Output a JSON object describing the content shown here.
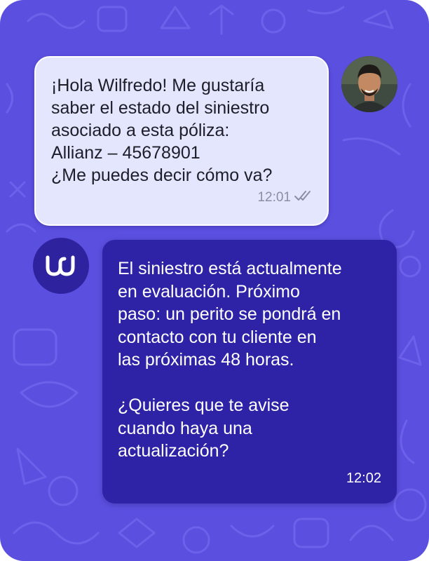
{
  "chat": {
    "user_message": {
      "text": "¡Hola Wilfredo! Me gustaría\nsaber el estado del siniestro\nasociado a esta póliza:\n Allianz – 45678901\n¿Me puedes decir cómo va?",
      "time": "12:01",
      "status_icon": "double-check-icon",
      "avatar_icon": "user-avatar"
    },
    "bot_message": {
      "text": "El siniestro está actualmente\nen evaluación. Próximo\npaso: un perito se pondrá en\ncontacto con tu cliente en\nlas próximas 48 horas.\n\n¿Quieres que te avise\ncuando haya una\nactualización?",
      "time": "12:02",
      "avatar_icon": "wilfredo-logo-icon"
    }
  },
  "colors": {
    "background": "#5b4fe0",
    "user_bubble": "#e3e6fd",
    "bot_bubble": "#2e23a6",
    "bot_avatar": "#2e229e",
    "timestamp_user": "#8b8ea3"
  }
}
